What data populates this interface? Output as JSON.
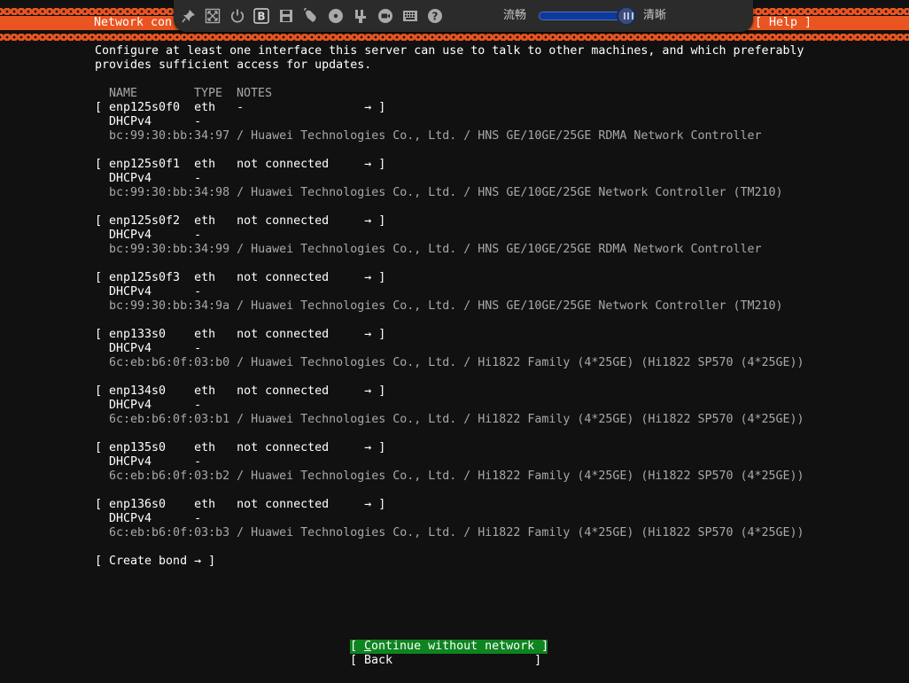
{
  "title_bar": {
    "title": "Network con",
    "help": "[ Help ]"
  },
  "toolbar": {
    "icons": [
      "pin-icon",
      "fit-screen-icon",
      "power-icon",
      "bold-b-icon",
      "save-icon",
      "mouse-icon",
      "disc-icon",
      "usb-icon",
      "camera-icon",
      "keyboard-icon",
      "help-circle-icon"
    ],
    "help_glyph": "?",
    "label_smooth": "流畅",
    "label_clear": "清晰",
    "quality_level": 0.9
  },
  "intro": {
    "line1": "Configure at least one interface this server can use to talk to other machines, and which preferably",
    "line2": "provides sufficient access for updates."
  },
  "table_header": {
    "name": "NAME",
    "type": "TYPE",
    "notes": "NOTES"
  },
  "interfaces": [
    {
      "row": "[ enp125s0f0  eth   -                 → ]",
      "dhcp": "  DHCPv4      -",
      "detail": "  bc:99:30:bb:34:97 / Huawei Technologies Co., Ltd. / HNS GE/10GE/25GE RDMA Network Controller"
    },
    {
      "row": "[ enp125s0f1  eth   not connected     → ]",
      "dhcp": "  DHCPv4      -",
      "detail": "  bc:99:30:bb:34:98 / Huawei Technologies Co., Ltd. / HNS GE/10GE/25GE Network Controller (TM210)"
    },
    {
      "row": "[ enp125s0f2  eth   not connected     → ]",
      "dhcp": "  DHCPv4      -",
      "detail": "  bc:99:30:bb:34:99 / Huawei Technologies Co., Ltd. / HNS GE/10GE/25GE RDMA Network Controller"
    },
    {
      "row": "[ enp125s0f3  eth   not connected     → ]",
      "dhcp": "  DHCPv4      -",
      "detail": "  bc:99:30:bb:34:9a / Huawei Technologies Co., Ltd. / HNS GE/10GE/25GE Network Controller (TM210)"
    },
    {
      "row": "[ enp133s0    eth   not connected     → ]",
      "dhcp": "  DHCPv4      -",
      "detail": "  6c:eb:b6:0f:03:b0 / Huawei Technologies Co., Ltd. / Hi1822 Family (4*25GE) (Hi1822 SP570 (4*25GE))"
    },
    {
      "row": "[ enp134s0    eth   not connected     → ]",
      "dhcp": "  DHCPv4      -",
      "detail": "  6c:eb:b6:0f:03:b1 / Huawei Technologies Co., Ltd. / Hi1822 Family (4*25GE) (Hi1822 SP570 (4*25GE))"
    },
    {
      "row": "[ enp135s0    eth   not connected     → ]",
      "dhcp": "  DHCPv4      -",
      "detail": "  6c:eb:b6:0f:03:b2 / Huawei Technologies Co., Ltd. / Hi1822 Family (4*25GE) (Hi1822 SP570 (4*25GE))"
    },
    {
      "row": "[ enp136s0    eth   not connected     → ]",
      "dhcp": "  DHCPv4      -",
      "detail": "  6c:eb:b6:0f:03:b3 / Huawei Technologies Co., Ltd. / Hi1822 Family (4*25GE) (Hi1822 SP570 (4*25GE))"
    }
  ],
  "create_bond": "[ Create bond → ]",
  "buttons": {
    "continue_open": "[ ",
    "continue_hotkey": "C",
    "continue_rest": "ontinue without network ]",
    "back": "[ Back                    ]"
  },
  "colors": {
    "accent": "#e95420",
    "background": "#111111",
    "focus_button": "#0e8420",
    "dim_text": "#a8a8a8"
  }
}
